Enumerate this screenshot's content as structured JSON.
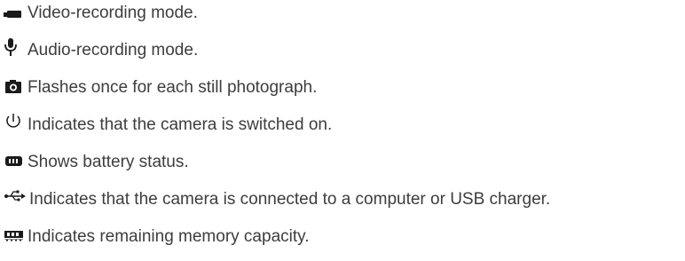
{
  "items": [
    {
      "icon": "video-camera-icon",
      "text": "Video-recording mode."
    },
    {
      "icon": "microphone-icon",
      "text": "Audio-recording mode."
    },
    {
      "icon": "still-camera-icon",
      "text": "Flashes once for each still photograph."
    },
    {
      "icon": "power-icon",
      "text": "Indicates that the camera is switched on."
    },
    {
      "icon": "battery-icon",
      "text": "Shows battery status."
    },
    {
      "icon": "usb-icon",
      "text": "Indicates that the camera is connected to a computer or USB charger."
    },
    {
      "icon": "memory-card-icon",
      "text": "Indicates remaining memory capacity."
    }
  ],
  "colors": {
    "text": "#3d3d3d",
    "icon": "#1a1a1a"
  }
}
